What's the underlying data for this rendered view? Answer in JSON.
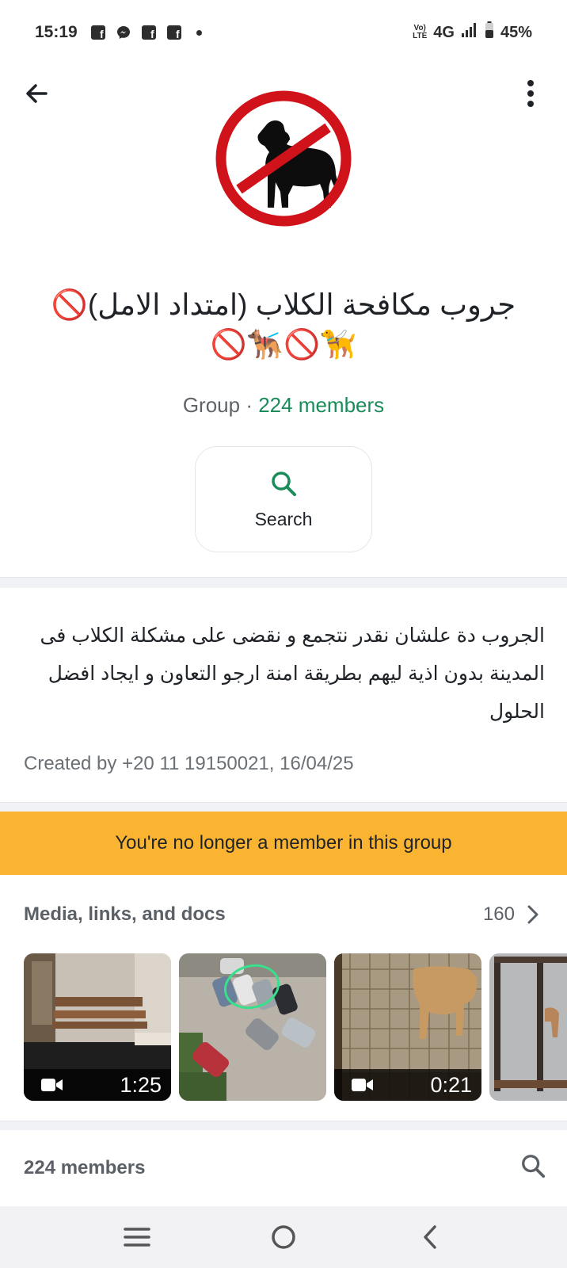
{
  "status_bar": {
    "time": "15:19",
    "network": "4G",
    "volte": "VoLTE",
    "battery": "45%",
    "notification_icons": [
      "facebook-icon",
      "messenger-icon",
      "facebook-icon",
      "facebook-icon",
      "dot-icon"
    ]
  },
  "header": {
    "back_icon": "arrow-left-icon",
    "menu_icon": "more-vertical-icon",
    "avatar_icon": "no-dogs-sign-icon"
  },
  "group": {
    "title": "جروب مكافحة الكلاب (امتداد الامل)🚫",
    "title_emoji_line": "🚫🐕‍🦺🚫🦮",
    "type": "Group · ",
    "members_link": "224 members"
  },
  "search_action": {
    "label": "Search",
    "icon": "search-icon"
  },
  "description": {
    "text": "الجروب دة علشان نقدر نتجمع و نقضى على مشكلة الكلاب فى المدينة بدون اذية ليهم بطريقة امنة ارجو التعاون و ايجاد افضل الحلول",
    "created_by": "Created by +20 11 19150021, 16/04/25"
  },
  "notice": {
    "text": "You're no longer a member in this group",
    "color": "#fbb431"
  },
  "media": {
    "label": "Media, links, and docs",
    "count": "160",
    "items": [
      {
        "kind": "video",
        "duration": "1:25"
      },
      {
        "kind": "image",
        "duration": ""
      },
      {
        "kind": "video",
        "duration": "0:21"
      },
      {
        "kind": "image",
        "duration": ""
      }
    ]
  },
  "members_section": {
    "label": "224 members",
    "search_icon": "search-icon"
  },
  "nav_bar": {
    "icons": [
      "recent-apps-icon",
      "home-icon",
      "back-icon"
    ]
  },
  "colors": {
    "accent_green": "#1a8c5a",
    "warning_yellow": "#fbb431",
    "sign_red": "#d0121a"
  }
}
